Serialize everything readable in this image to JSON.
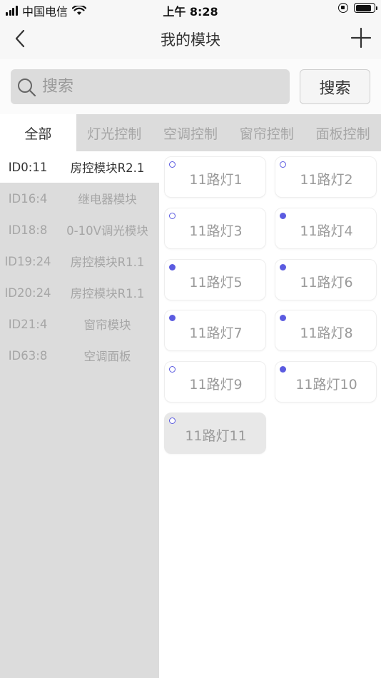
{
  "status_bar": {
    "carrier": "中国电信",
    "time": "上午 8:28"
  },
  "nav": {
    "title": "我的模块",
    "back_icon": "chevron-left-icon",
    "add_icon": "plus-icon"
  },
  "search": {
    "placeholder": "搜索",
    "value": "",
    "button_label": "搜索"
  },
  "tabs": [
    {
      "label": "全部",
      "active": true
    },
    {
      "label": "灯光控制",
      "active": false
    },
    {
      "label": "空调控制",
      "active": false
    },
    {
      "label": "窗帘控制",
      "active": false
    },
    {
      "label": "面板控制",
      "active": false
    }
  ],
  "modules": [
    {
      "id": "ID0:11",
      "name": "房控模块R2.1",
      "active": true
    },
    {
      "id": "ID16:4",
      "name": "继电器模块",
      "active": false
    },
    {
      "id": "ID18:8",
      "name": "0-10V调光模块",
      "active": false
    },
    {
      "id": "ID19:24",
      "name": "房控模块R1.1",
      "active": false
    },
    {
      "id": "ID20:24",
      "name": "房控模块R1.1",
      "active": false
    },
    {
      "id": "ID21:4",
      "name": "窗帘模块",
      "active": false
    },
    {
      "id": "ID63:8",
      "name": "空调面板",
      "active": false
    }
  ],
  "lights": [
    {
      "label": "11路灯1",
      "on": false
    },
    {
      "label": "11路灯2",
      "on": false
    },
    {
      "label": "11路灯3",
      "on": false
    },
    {
      "label": "11路灯4",
      "on": true
    },
    {
      "label": "11路灯5",
      "on": true
    },
    {
      "label": "11路灯6",
      "on": true
    },
    {
      "label": "11路灯7",
      "on": true
    },
    {
      "label": "11路灯8",
      "on": true
    },
    {
      "label": "11路灯9",
      "on": false
    },
    {
      "label": "11路灯10",
      "on": true
    },
    {
      "label": "11路灯11",
      "on": false,
      "selected": true
    }
  ],
  "colors": {
    "accent": "#5b5be0",
    "panel_gray": "#dcdcdc"
  }
}
